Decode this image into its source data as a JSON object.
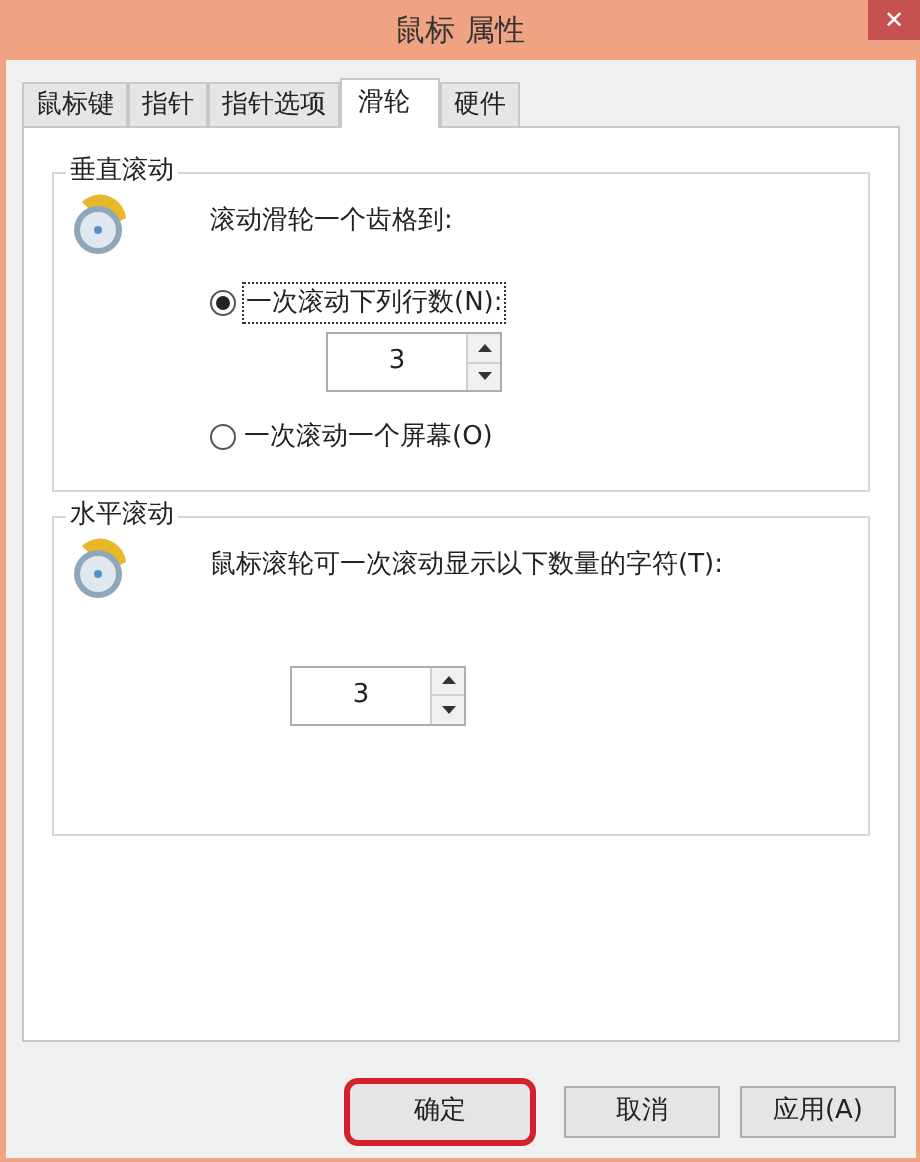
{
  "window": {
    "title": "鼠标 属性",
    "close": "✕"
  },
  "tabs": [
    {
      "label": "鼠标键",
      "selected": false
    },
    {
      "label": "指针",
      "selected": false
    },
    {
      "label": "指针选项",
      "selected": false
    },
    {
      "label": "滑轮",
      "selected": true
    },
    {
      "label": "硬件",
      "selected": false
    }
  ],
  "vertical_scroll": {
    "title": "垂直滚动",
    "prompt": "滚动滑轮一个齿格到:",
    "options": [
      {
        "label": "一次滚动下列行数(N):",
        "selected": true
      },
      {
        "label": "一次滚动一个屏幕(O)",
        "selected": false
      }
    ],
    "value": "3"
  },
  "horizontal_scroll": {
    "title": "水平滚动",
    "prompt": "鼠标滚轮可一次滚动显示以下数量的字符(T):",
    "value": "3"
  },
  "buttons": [
    {
      "label": "确定",
      "highlighted": true
    },
    {
      "label": "取消",
      "highlighted": false
    },
    {
      "label": "应用(A)",
      "highlighted": false
    }
  ]
}
